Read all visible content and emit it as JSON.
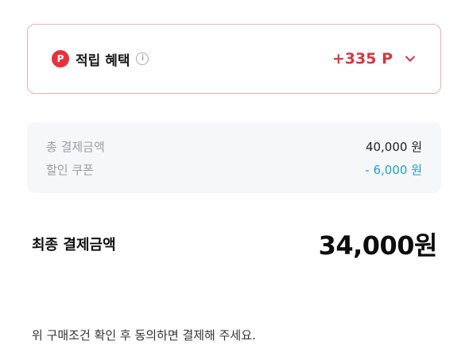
{
  "points": {
    "badge": "P",
    "label": "적립 혜택",
    "info": "i",
    "value": "+335 P"
  },
  "summary": {
    "rows": [
      {
        "label": "총 결제금액",
        "value": "40,000 원"
      },
      {
        "label": "할인 쿠폰",
        "value": "- 6,000 원"
      }
    ]
  },
  "final": {
    "label": "최종 결제금액",
    "value": "34,000원"
  },
  "agreement": "위 구매조건 확인 후 동의하면 결제해 주세요.",
  "colors": {
    "accent_red": "#e8313d",
    "points_text": "#d9343f",
    "discount_blue": "#1f9ed2",
    "card_border": "#e9aeb4",
    "summary_bg": "#f6f7f9"
  }
}
